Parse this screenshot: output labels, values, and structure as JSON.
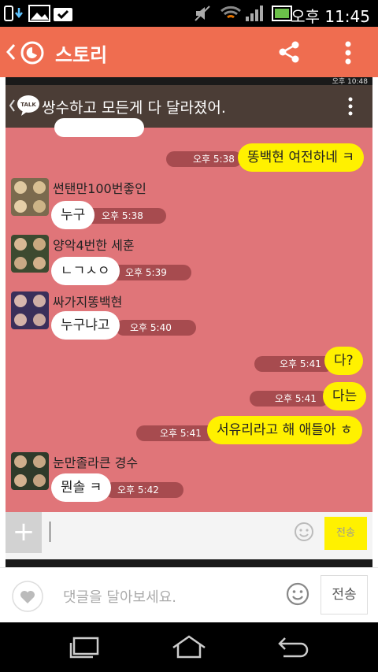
{
  "status_bar": {
    "time": "오후 11:45"
  },
  "header": {
    "title": "스토리"
  },
  "chat": {
    "inner_time": "오후 10:48",
    "title": "쌍수하고 모든게 다 달라졌어.",
    "messages": [
      {
        "type": "out",
        "text": "똥백현 여전하네 ㅋ",
        "time": "오후 5:38"
      },
      {
        "type": "in",
        "sender": "썬탠만100번좋인",
        "text": "누구",
        "time": "오후 5:38"
      },
      {
        "type": "in",
        "sender": "양악4번한 세훈",
        "text": "ㄴㄱㅅㅇ",
        "time": "오후 5:39"
      },
      {
        "type": "in",
        "sender": "싸가지똥백현",
        "text": "누구냐고",
        "time": "오후 5:40"
      },
      {
        "type": "out",
        "text": "다?",
        "time": "오후 5:41"
      },
      {
        "type": "out",
        "text": "다는",
        "time": "오후 5:41"
      },
      {
        "type": "out",
        "text": "서유리라고 해 애들아 ㅎ",
        "time": "오후 5:41"
      },
      {
        "type": "in",
        "sender": "눈만졸라큰 경수",
        "text": "뭔솔 ㅋ",
        "time": "오후 5:42"
      }
    ],
    "send_label": "전송"
  },
  "comment": {
    "placeholder": "댓글을 달아보세요.",
    "send_label": "전송"
  },
  "colors": {
    "header": "#ef6d50",
    "chat_bg": "#e07579",
    "my_bubble": "#fff100"
  }
}
